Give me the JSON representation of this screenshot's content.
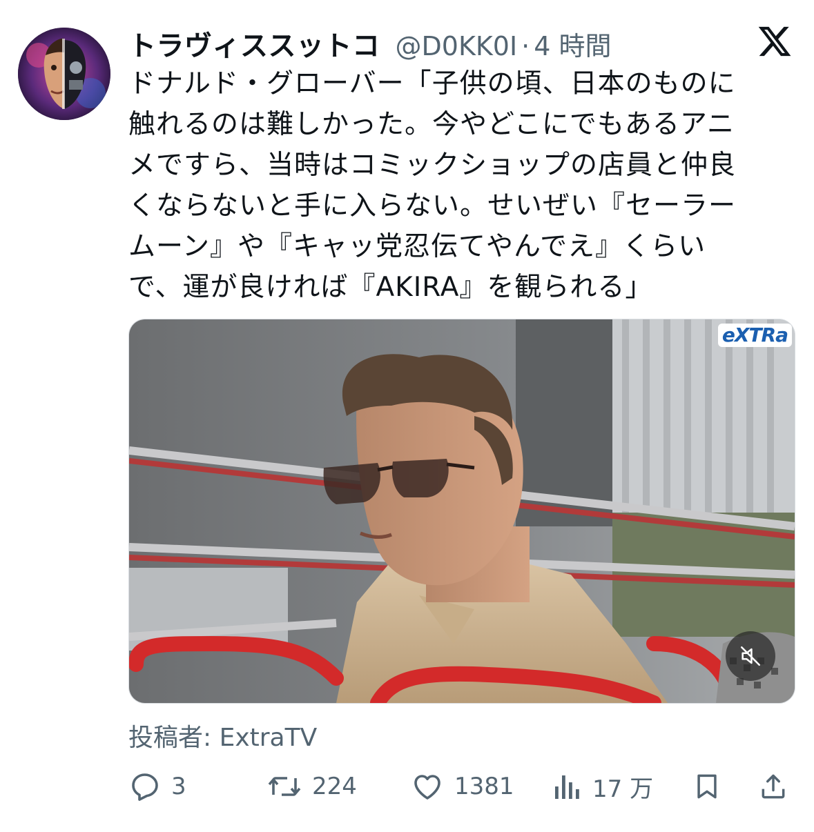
{
  "tweet": {
    "display_name": "トラヴィススットコ",
    "handle": "@D0KK0I",
    "separator": "·",
    "time": "4 時間",
    "text": "ドナルド・グローバー「子供の頃、日本のものに\n触れるのは難しかった。今やどこにでもあるアニ\nメですら、当時はコミックショップの店員と仲良\nくならないと手に入らない。せいぜい『セーラー\nムーン』や『キャッ党忍伝てやんでえ』くらい\nで、運が良ければ『AKIRA』を観られる」",
    "media": {
      "brand": "eXTRa",
      "mute_icon": "speaker-muted-icon"
    },
    "source": "投稿者: ExtraTV",
    "actions": {
      "replies": "3",
      "reposts": "224",
      "likes": "1381",
      "views": "17 万"
    }
  },
  "icons": {
    "logo": "x-logo-icon",
    "reply": "speech-bubble-icon",
    "repost": "repost-arrows-icon",
    "like": "heart-icon",
    "views": "bar-chart-icon",
    "bookmark": "bookmark-icon",
    "share": "share-icon"
  },
  "colors": {
    "text": "#0f1419",
    "secondary": "#536471"
  }
}
